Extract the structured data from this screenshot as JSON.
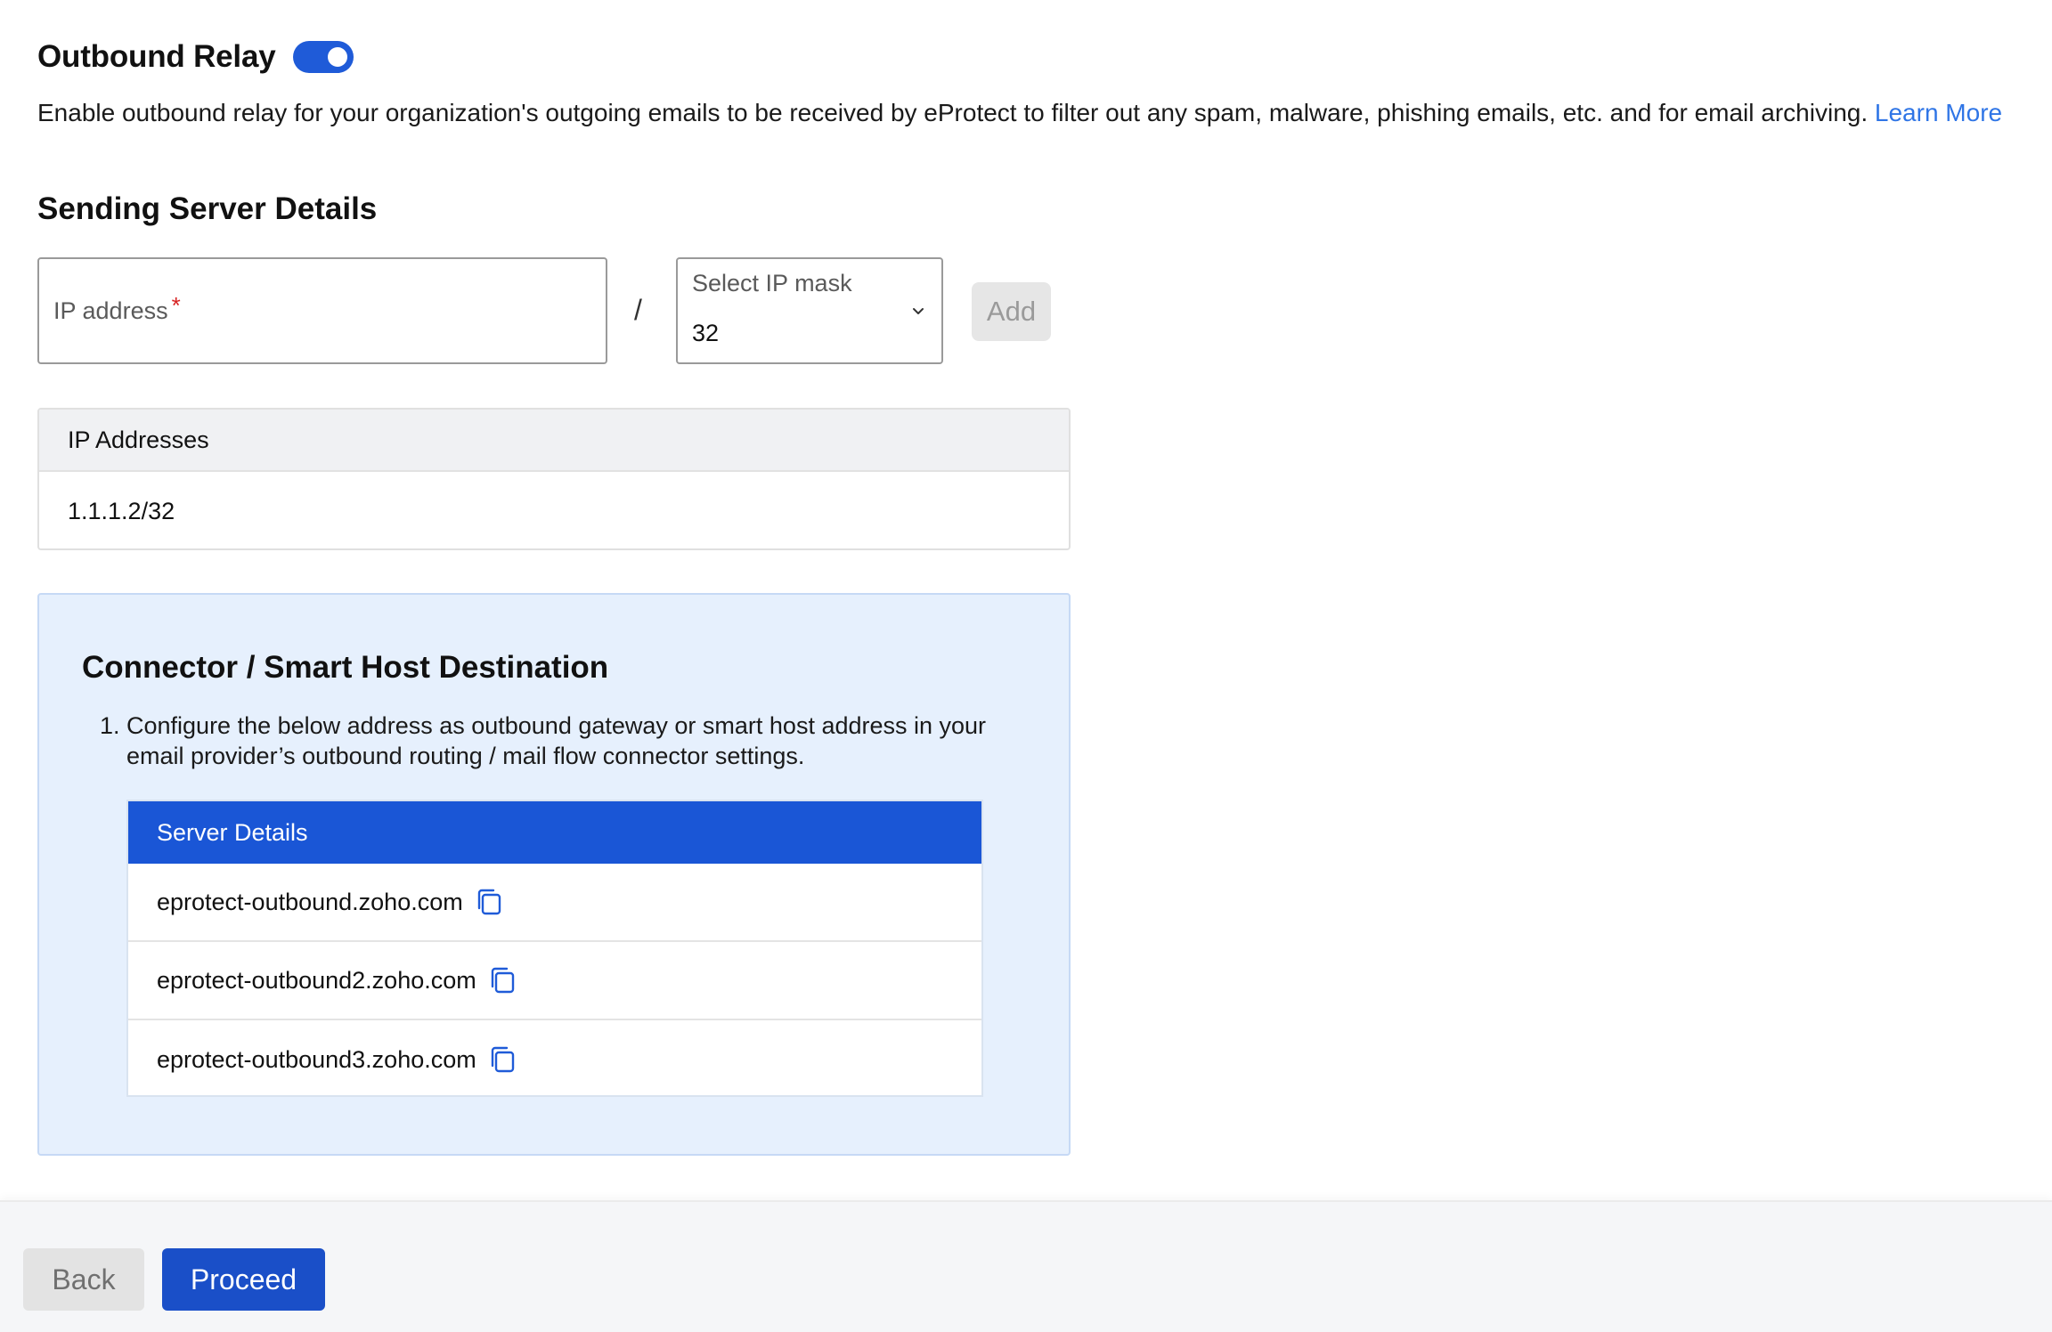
{
  "header": {
    "title": "Outbound Relay",
    "toggle_on": true,
    "description": "Enable outbound relay for your organization's outgoing emails to be received by eProtect to filter out any spam, malware, phishing emails, etc. and for email archiving.",
    "learn_more": "Learn More"
  },
  "sending": {
    "title": "Sending Server Details",
    "ip_label": "IP address",
    "required_mark": "*",
    "slash": "/",
    "mask_label": "Select IP mask",
    "mask_value": "32",
    "add_label": "Add"
  },
  "ip_table": {
    "header": "IP Addresses",
    "rows": [
      "1.1.1.2/32"
    ]
  },
  "connector": {
    "title": "Connector / Smart Host Destination",
    "step_number": "1.",
    "step_text": "Configure the below address as outbound gateway or smart host address in your email provider’s outbound routing / mail flow connector settings.",
    "table_header": "Server Details",
    "servers": [
      "eprotect-outbound.zoho.com",
      "eprotect-outbound2.zoho.com",
      "eprotect-outbound3.zoho.com"
    ]
  },
  "footer": {
    "back_label": "Back",
    "proceed_label": "Proceed"
  },
  "colors": {
    "accent": "#1f5bd8",
    "link": "#2f75e6",
    "connector_bg": "#e6f0fd",
    "table_header": "#1a56d6"
  }
}
